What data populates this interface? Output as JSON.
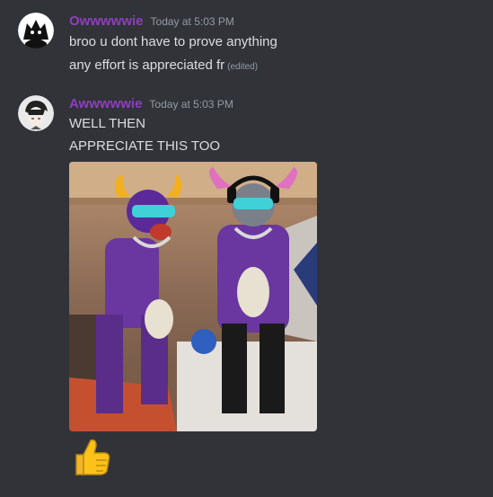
{
  "messages": [
    {
      "author": "Owwwwwie",
      "timestamp": "Today at 5:03 PM",
      "lines": [
        {
          "text": "broo u dont have to prove anything"
        },
        {
          "text": "any effort is appreciated fr",
          "edited": "(edited)"
        }
      ]
    },
    {
      "author": "Awwwwwie",
      "timestamp": "Today at 5:03 PM",
      "lines": [
        {
          "text": "WELL THEN"
        },
        {
          "text": "APPRECIATE THIS TOO"
        }
      ],
      "attachment": "gif",
      "emoji": "thumbs-up"
    }
  ],
  "colors": {
    "background": "#313338",
    "username": "#8e3fbf",
    "text": "#dbdee1",
    "timestamp": "#949ba4"
  }
}
